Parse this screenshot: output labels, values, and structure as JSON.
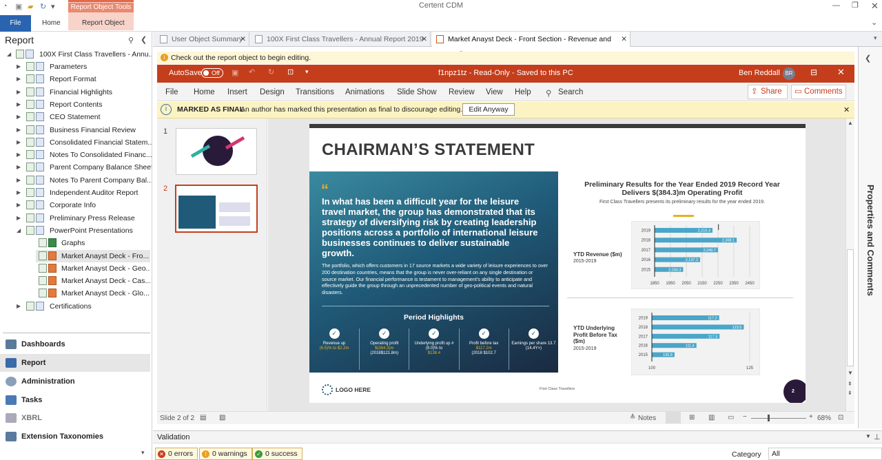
{
  "app": {
    "title": "Certent CDM",
    "contextual_tab": "Report Object Tools",
    "ribbon_tabs": [
      "File",
      "Home",
      "Report Object"
    ]
  },
  "left_pane": {
    "title": "Report",
    "root": "100X First Class Travellers - Annu...",
    "items": [
      "Parameters",
      "Report Format",
      "Financial Highlights",
      "Report Contents",
      "CEO Statement",
      "Business Financial Review",
      "Consolidated Financial Statem...",
      "Notes To Consolidated Financ...",
      "Parent Company Balance Sheet",
      "Notes To Parent Company Bal...",
      "Independent Auditor Report",
      "Corporate Info",
      "Preliminary Press Release",
      "PowerPoint Presentations"
    ],
    "children": [
      "Graphs",
      "Market Anayst Deck - Fro...",
      "Market Anayst Deck - Geo...",
      "Market Anayst Deck - Cas...",
      "Market Anayst Deck - Glo..."
    ],
    "last_item": "Certifications",
    "nav": [
      "Dashboards",
      "Report",
      "Administration",
      "Tasks",
      "XBRL",
      "Extension Taxonomies"
    ]
  },
  "doc_tabs": [
    "User Object Summary",
    "100X First Class Travellers - Annual Report 2019 V2",
    "Market Anayst Deck - Front Section - Revenue and Profit"
  ],
  "info_bar": "Check out the report object to begin editing.",
  "ppt": {
    "autosave": "AutoSave",
    "autosave_state": "Off",
    "doc_title": "f1npz1tz  -  Read-Only  -  Saved to this PC",
    "user": "Ben Reddall",
    "initials": "BR",
    "menu": [
      "File",
      "Home",
      "Insert",
      "Design",
      "Transitions",
      "Animations",
      "Slide Show",
      "Review",
      "View",
      "Help"
    ],
    "search": "Search",
    "share": "Share",
    "comments": "Comments",
    "final_label": "MARKED AS FINAL",
    "final_text": "An author has marked this presentation as final to discourage editing.",
    "edit_anyway": "Edit Anyway",
    "slide_numbers": [
      "1",
      "2"
    ],
    "status_slide": "Slide 2 of 2",
    "notes": "Notes",
    "zoom": "68%"
  },
  "slide": {
    "heading": "CHAIRMAN’S STATEMENT",
    "quote": "In what has been a difficult year for the leisure travel market, the group has demonstrated that its strategy of diversifying risk by creating leadership positions across a portfolio of international leisure businesses continues to deliver sustainable growth.",
    "body": "The portfolio, which offers customers in 17 source markets a wide variety of leisure experiences to over 200 destination countries, means that the group is never over-reliant on any single destination or source market. Our financial performance is testament to management's ability to anticipate and effectively guide the group through an unprecedented number of geo-political events and natural disasters.",
    "period_title": "Period Highlights",
    "highlights": [
      {
        "a": "Revenue up",
        "b": "(6.5)% to $2.2m",
        "c": ""
      },
      {
        "a": "Operating profit",
        "b": "$(384.3)m",
        "c": "(2018$121.8m)"
      },
      {
        "a": "Underlying profit up #(9.0)% to",
        "b": "$138.4",
        "c": ""
      },
      {
        "a": "Profit before tax",
        "b": "$117.2m",
        "c": "(2018 $102.7"
      },
      {
        "a": "Earnings per share 13.7",
        "b": "",
        "c": "(14.4Y>)"
      }
    ],
    "results_title": "Preliminary Results for the Year Ended 2019 Record Year Delivers $(384.3)m Operating Profit",
    "results_sub": "First Class Travellers presents its preliminary results for the year ended 2019.",
    "chart1_label": "YTD Revenue ($m)",
    "chart1_range": "2015-2019",
    "chart2_label": "YTD Underlying Profit Before Tax ($m)",
    "chart2_range": "2015-2019",
    "logo": "LOGO HERE",
    "footer": "First Class Travellers",
    "page": "2"
  },
  "chart_data": [
    {
      "type": "bar",
      "categories": [
        "2019",
        "2018",
        "2017",
        "2016",
        "2015"
      ],
      "values": [
        2215.3,
        2368.1,
        2249.7,
        2137.2,
        2030.3
      ],
      "data_labels": [
        "2,215.3",
        "2,368.1",
        "2,249.7",
        "2,137.2",
        "2,030.3"
      ],
      "xticks": [
        "1850",
        "1950",
        "2050",
        "2150",
        "2250",
        "2350",
        "2450"
      ],
      "xlim": [
        1850,
        2450
      ],
      "color": "#4aa6c8"
    },
    {
      "type": "bar",
      "categories": [
        "2019",
        "2018",
        "2017",
        "2016",
        "2015"
      ],
      "values": [
        117.2,
        123.5,
        117.3,
        111.4,
        105.8
      ],
      "data_labels": [
        "117.2",
        "123.5",
        "117.3",
        "111.4",
        "105.8"
      ],
      "xticks": [
        "100",
        "125"
      ],
      "xlim": [
        100,
        125
      ],
      "color": "#4aa6c8"
    }
  ],
  "right_pane": "Properties and Comments",
  "validation": {
    "title": "Validation",
    "errors": "0 errors",
    "warnings": "0 warnings",
    "success": "0 success",
    "category_label": "Category",
    "category_value": "All"
  }
}
